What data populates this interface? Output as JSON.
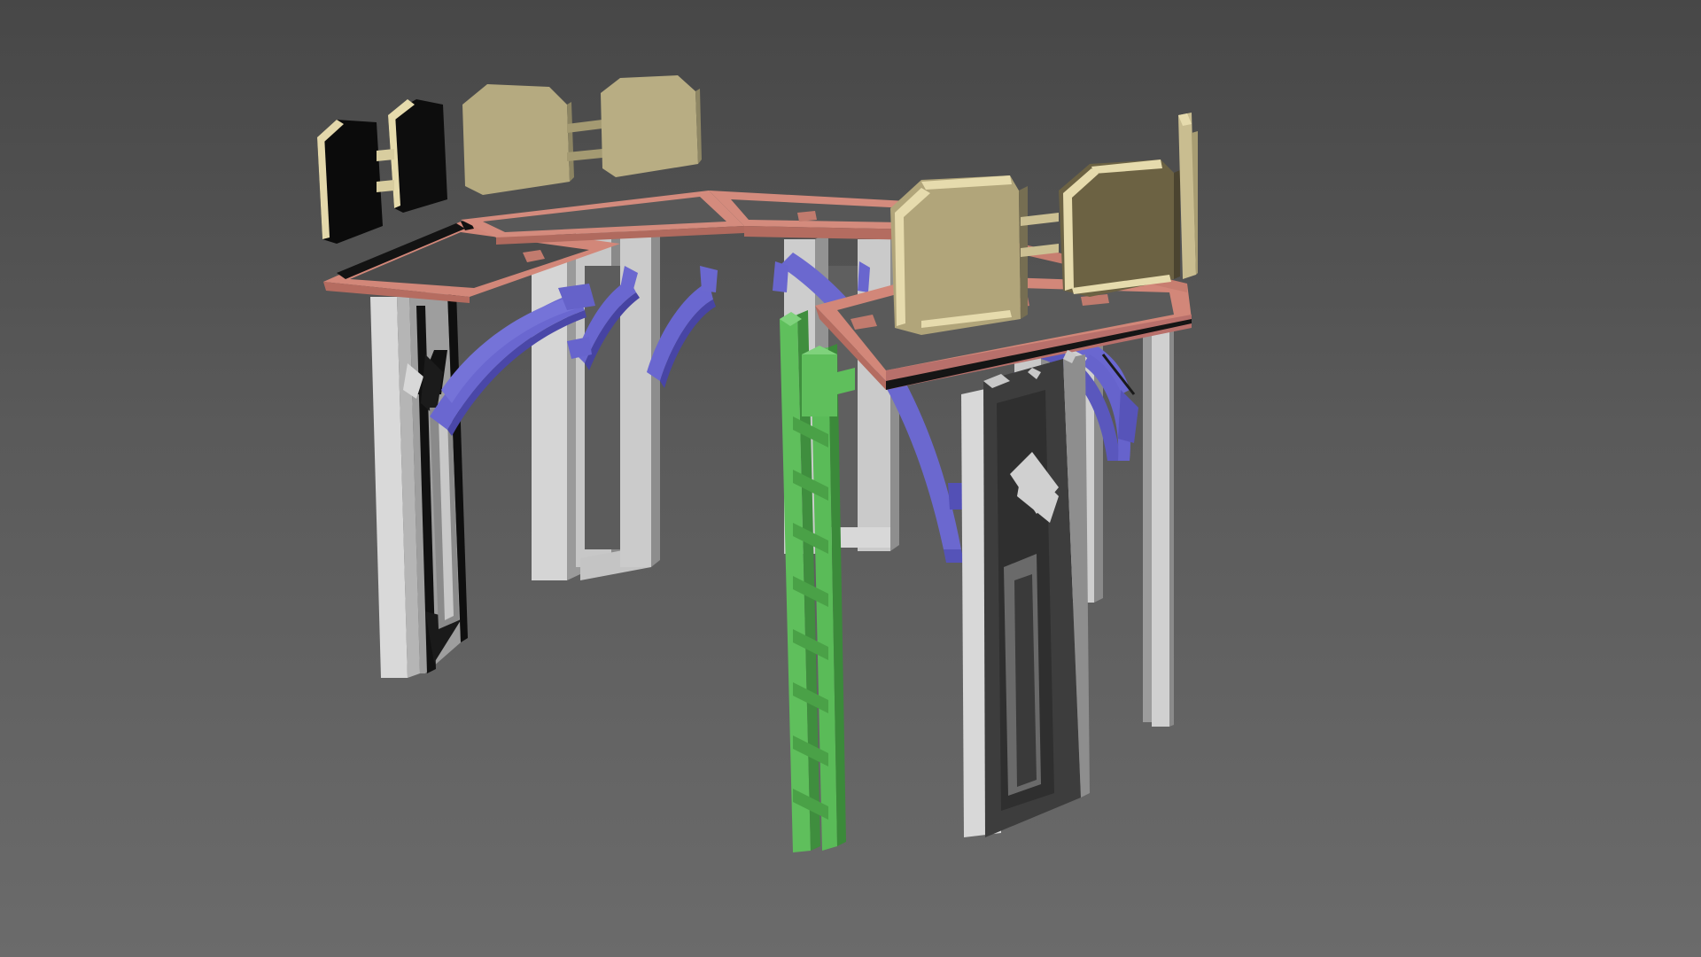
{
  "scene": {
    "background_top": "#474747",
    "background_bottom": "#6b6b6b",
    "parts": [
      {
        "name": "frame-pink",
        "color": "#d58a7c"
      },
      {
        "name": "arch-brace-blue",
        "color": "#6b68cf"
      },
      {
        "name": "ladder-green",
        "color": "#5fbe5c"
      },
      {
        "name": "post-light-gray",
        "color": "#cfcfcf"
      },
      {
        "name": "post-dark-gray",
        "color": "#3c3c3c"
      },
      {
        "name": "panel-beige",
        "color": "#b8ad82"
      },
      {
        "name": "panel-black",
        "color": "#0b0b0b"
      },
      {
        "name": "edge-cream",
        "color": "#e7dcae"
      }
    ]
  }
}
